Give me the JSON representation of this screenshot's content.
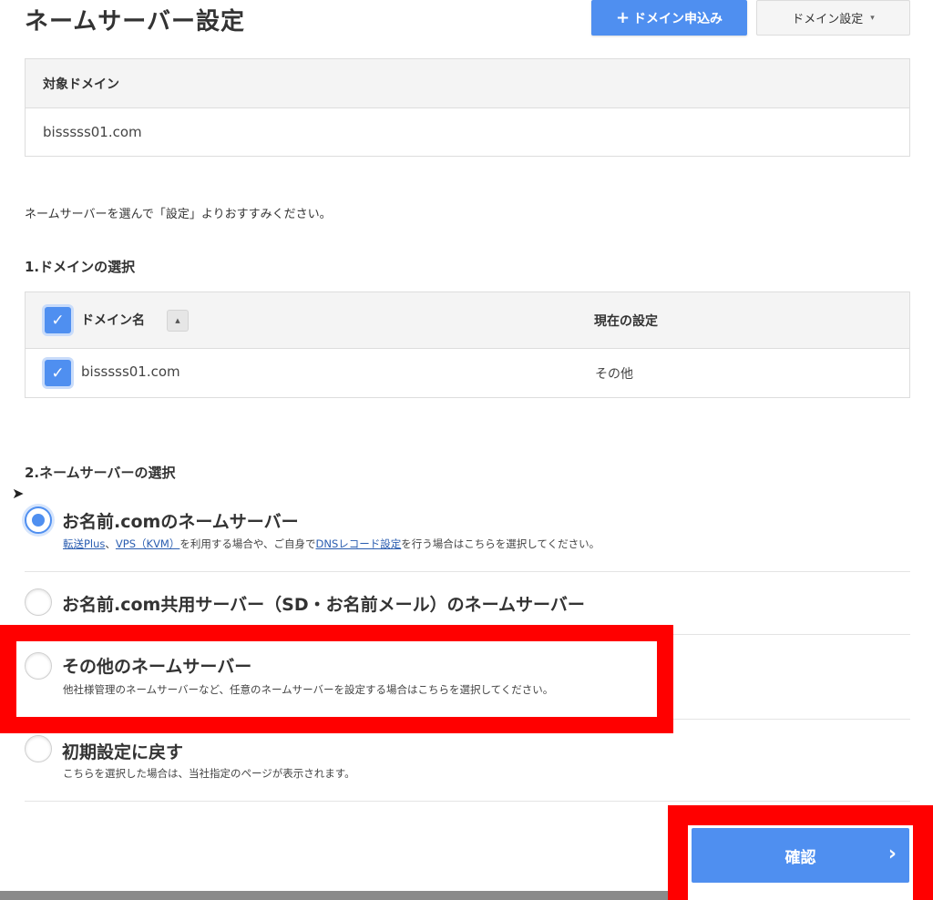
{
  "header": {
    "title": "ネームサーバー設定",
    "apply_button": "ドメイン申込み",
    "apply_icon": "+",
    "setting_button": "ドメイン設定",
    "setting_caret": "▾"
  },
  "target": {
    "heading": "対象ドメイン",
    "domain": "bisssss01.com"
  },
  "instruction": "ネームサーバーを選んで「設定」よりおすすみください。",
  "section1": {
    "title": "1.ドメインの選択",
    "col_name": "ドメイン名",
    "col_current": "現在の設定",
    "sort_icon": "▲",
    "rows": [
      {
        "domain": "bisssss01.com",
        "current": "その他"
      }
    ]
  },
  "section2": {
    "title": "2.ネームサーバーの選択",
    "options": [
      {
        "label": "お名前.comのネームサーバー",
        "link1": "転送Plus",
        "sep1": "、",
        "link2": "VPS（KVM）",
        "mid": "を利用する場合や、ご自身で",
        "link3": "DNSレコード設定",
        "tail": "を行う場合はこちらを選択してください。",
        "checked": true
      },
      {
        "label": "お名前.com共用サーバー（SD・お名前メール）のネームサーバー",
        "checked": false
      },
      {
        "label": "その他のネームサーバー",
        "desc": "他社様管理のネームサーバーなど、任意のネームサーバーを設定する場合はこちらを選択してください。",
        "checked": false
      },
      {
        "label": "初期設定に戻す",
        "desc": "こちらを選択した場合は、当社指定のページが表示されます。",
        "checked": false
      }
    ]
  },
  "confirm": {
    "label": "確認",
    "chevron": "›"
  },
  "colors": {
    "accent": "#4f8ff0",
    "highlight": "#ff0000"
  }
}
